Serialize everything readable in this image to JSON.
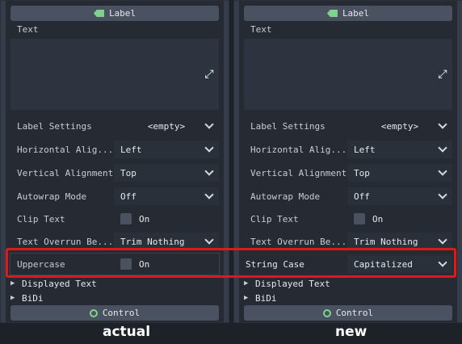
{
  "panels": {
    "actual": {
      "header": "Label",
      "text_label": "Text",
      "rows": {
        "label_settings": {
          "name": "Label Settings",
          "value": "<empty>"
        },
        "h_align": {
          "name": "Horizontal Alig...",
          "value": "Left"
        },
        "v_align": {
          "name": "Vertical Alignment",
          "value": "Top"
        },
        "autowrap": {
          "name": "Autowrap Mode",
          "value": "Off"
        },
        "clip_text": {
          "name": "Clip Text",
          "value": "On"
        },
        "overrun": {
          "name": "Text Overrun Be...",
          "value": "Trim Nothing"
        },
        "highlighted": {
          "name": "Uppercase",
          "value": "On"
        }
      },
      "sections": [
        "Displayed Text",
        "BiDi"
      ],
      "footer": "Control",
      "caption": "actual"
    },
    "new": {
      "header": "Label",
      "text_label": "Text",
      "rows": {
        "label_settings": {
          "name": "Label Settings",
          "value": "<empty>"
        },
        "h_align": {
          "name": "Horizontal Alig...",
          "value": "Left"
        },
        "v_align": {
          "name": "Vertical Alignment",
          "value": "Top"
        },
        "autowrap": {
          "name": "Autowrap Mode",
          "value": "Off"
        },
        "clip_text": {
          "name": "Clip Text",
          "value": "On"
        },
        "overrun": {
          "name": "Text Overrun Be...",
          "value": "Trim Nothing"
        },
        "highlighted": {
          "name": "String Case",
          "value": "Capitalized"
        }
      },
      "sections": [
        "Displayed Text",
        "BiDi"
      ],
      "footer": "Control",
      "caption": "new"
    }
  },
  "icons": {
    "header": "label-tag-icon",
    "expand": "expand-icon",
    "footer": "control-ring-icon",
    "section": "chevron-right-icon"
  },
  "colors": {
    "accent_green": "#7ed48c",
    "highlight_red": "#e01818"
  }
}
